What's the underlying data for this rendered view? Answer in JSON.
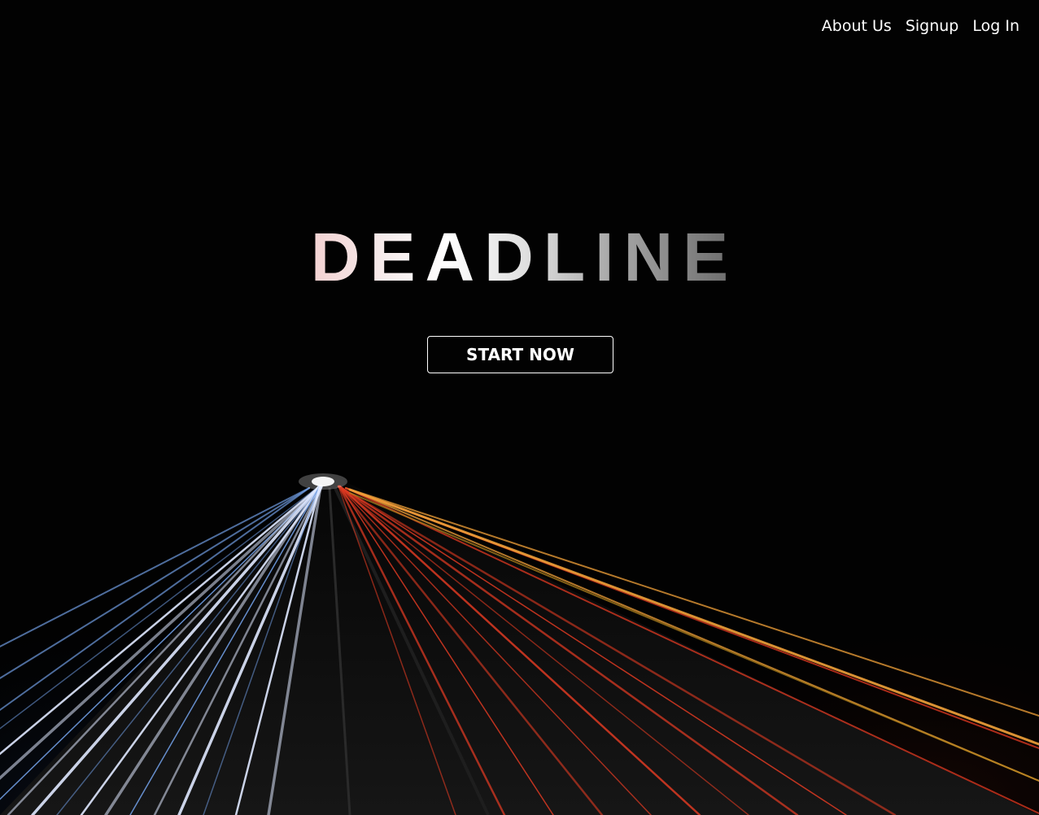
{
  "nav": {
    "items": [
      {
        "label": "About Us"
      },
      {
        "label": "Signup"
      },
      {
        "label": "Log In"
      }
    ]
  },
  "hero": {
    "title": "DEADLINE",
    "cta_label": "START NOW"
  },
  "colors": {
    "background": "#020202",
    "text": "#ffffff",
    "trail_white": "#dfe8ff",
    "trail_blue": "#6f9be0",
    "trail_red": "#e03a22",
    "trail_orange": "#f2a23a"
  },
  "background_image": {
    "subject": "long-exposure highway light trails at night"
  }
}
